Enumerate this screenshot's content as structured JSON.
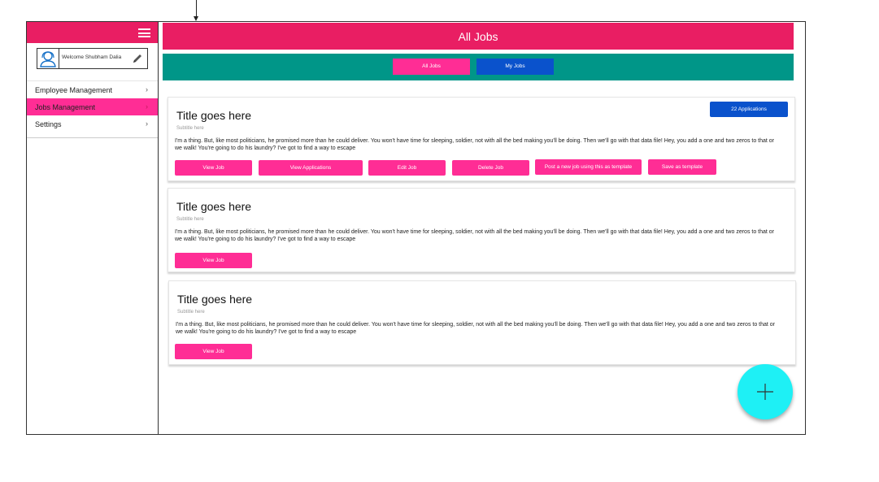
{
  "sidebar": {
    "welcome_text": "Welcome Shubham Dalia",
    "items": [
      {
        "label": "Employee Management",
        "chevron": "›"
      },
      {
        "label": "Jobs Management",
        "chevron": "›"
      },
      {
        "label": "Settings",
        "chevron": "›"
      }
    ]
  },
  "header": {
    "title": "All Jobs"
  },
  "tabs": {
    "all_jobs": "All Jobs",
    "my_jobs": "My Jobs"
  },
  "jobs": [
    {
      "title": "Title goes here",
      "subtitle": "Subtitle here",
      "body": "I'm a thing. But, like most politicians, he promised more than he could deliver. You won't have time for sleeping, soldier, not with all the bed making you'll be doing. Then we'll go with that data file! Hey, you add a one and two zeros to that or we walk! You're going to do his laundry? I've got to find a way to escape",
      "applications_badge": "22 Applications",
      "buttons": {
        "view_job": "View Job",
        "view_applications": "View Applications",
        "edit_job": "Edit Job",
        "delete_job": "Delete Job",
        "post_template": "Post a new job using this as template",
        "save_template": "Save as template"
      }
    },
    {
      "title": "Title goes here",
      "subtitle": "Subtitle here",
      "body": "I'm a thing. But, like most politicians, he promised more than he could deliver. You won't have time for sleeping, soldier, not with all the bed making you'll be doing. Then we'll go with that data file! Hey, you add a one and two zeros to that or we walk! You're going to do his laundry? I've got to find a way to escape",
      "buttons": {
        "view_job": "View Job"
      }
    },
    {
      "title": "Title goes here",
      "subtitle": "Subtitle here",
      "body": "I'm a thing. But, like most politicians, he promised more than he could deliver. You won't have time for sleeping, soldier, not with all the bed making you'll be doing. Then we'll go with that data file! Hey, you add a one and two zeros to that or we walk! You're going to do his laundry? I've got to find a way to escape",
      "buttons": {
        "view_job": "View Job"
      }
    }
  ],
  "icons": {
    "menu": "hamburger-menu-icon",
    "user": "user-avatar-icon",
    "edit": "pencil-icon",
    "add": "plus-icon"
  },
  "colors": {
    "primary_pink": "#e91e63",
    "button_pink": "#ff2d95",
    "teal": "#009688",
    "blue": "#0a52cc",
    "fab_cyan": "#1ef0f5"
  }
}
